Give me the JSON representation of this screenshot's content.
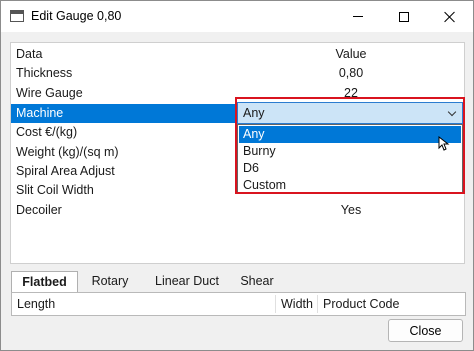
{
  "window": {
    "title": "Edit Gauge 0,80"
  },
  "grid": {
    "header": {
      "label": "Data",
      "value": "Value"
    },
    "rows": [
      {
        "label": "Thickness",
        "value": "0,80"
      },
      {
        "label": "Wire Gauge",
        "value": "22"
      },
      {
        "label": "Machine",
        "value": "Any"
      },
      {
        "label": "Cost €/(kg)",
        "value": ""
      },
      {
        "label": "Weight (kg)/(sq m)",
        "value": ""
      },
      {
        "label": "Spiral Area Adjust",
        "value": ""
      },
      {
        "label": "Slit Coil Width",
        "value": ""
      },
      {
        "label": "Decoiler",
        "value": "Yes"
      }
    ]
  },
  "machine_select": {
    "selected": "Any",
    "options": [
      "Any",
      "Burny",
      "D6",
      "Custom"
    ],
    "highlighted_index": 0
  },
  "tabs": [
    "Flatbed",
    "Rotary",
    "Linear Duct",
    "Shear"
  ],
  "active_tab": "Flatbed",
  "table": {
    "columns": [
      "Length",
      "Width",
      "Product Code"
    ]
  },
  "buttons": {
    "close": "Close"
  },
  "colors": {
    "selection": "#0078d7",
    "highlight_frame": "#d9141f"
  }
}
